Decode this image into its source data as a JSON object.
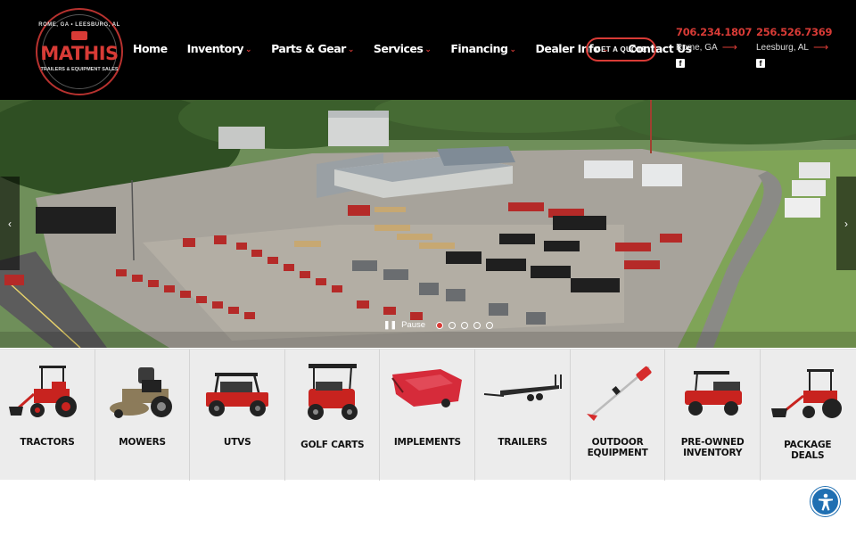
{
  "logo": {
    "top_text": "ROME, GA • LEESBURG, AL",
    "brand": "MATHIS",
    "bottom_text": "TRAILERS & EQUIPMENT SALES"
  },
  "nav": {
    "items": [
      {
        "label": "Home",
        "dropdown": false
      },
      {
        "label": "Inventory",
        "dropdown": true
      },
      {
        "label": "Parts & Gear",
        "dropdown": true
      },
      {
        "label": "Services",
        "dropdown": true
      },
      {
        "label": "Financing",
        "dropdown": true
      },
      {
        "label": "Dealer Info",
        "dropdown": true
      },
      {
        "label": "Contact Us",
        "dropdown": false
      }
    ]
  },
  "quote_button": "GET A QUOTE",
  "contacts": [
    {
      "phone": "706.234.1807",
      "location": "Rome, GA"
    },
    {
      "phone": "256.526.7369",
      "location": "Leesburg, AL"
    }
  ],
  "slider": {
    "pause_label": "Pause",
    "slide_count": 5,
    "active_slide": 1
  },
  "categories": [
    {
      "label": "TRACTORS",
      "icon": "tractor-icon"
    },
    {
      "label": "MOWERS",
      "icon": "mower-icon"
    },
    {
      "label": "UTVS",
      "icon": "utv-icon"
    },
    {
      "label": "GOLF CARTS",
      "icon": "golf-cart-icon"
    },
    {
      "label": "IMPLEMENTS",
      "icon": "implement-icon"
    },
    {
      "label": "TRAILERS",
      "icon": "trailer-icon"
    },
    {
      "label": "OUTDOOR EQUIPMENT",
      "line1": "OUTDOOR",
      "line2": "EQUIPMENT",
      "icon": "trimmer-icon"
    },
    {
      "label": "PRE-OWNED INVENTORY",
      "line1": "PRE-OWNED",
      "line2": "INVENTORY",
      "icon": "utility-vehicle-icon"
    },
    {
      "label": "PACKAGE DEALS",
      "line1": "PACKAGE",
      "line2": "DEALS",
      "icon": "package-deal-icon"
    }
  ],
  "colors": {
    "accent": "#d83b36",
    "header_bg": "#000000",
    "category_bg": "#ececec",
    "accessibility": "#1f6fb2"
  }
}
